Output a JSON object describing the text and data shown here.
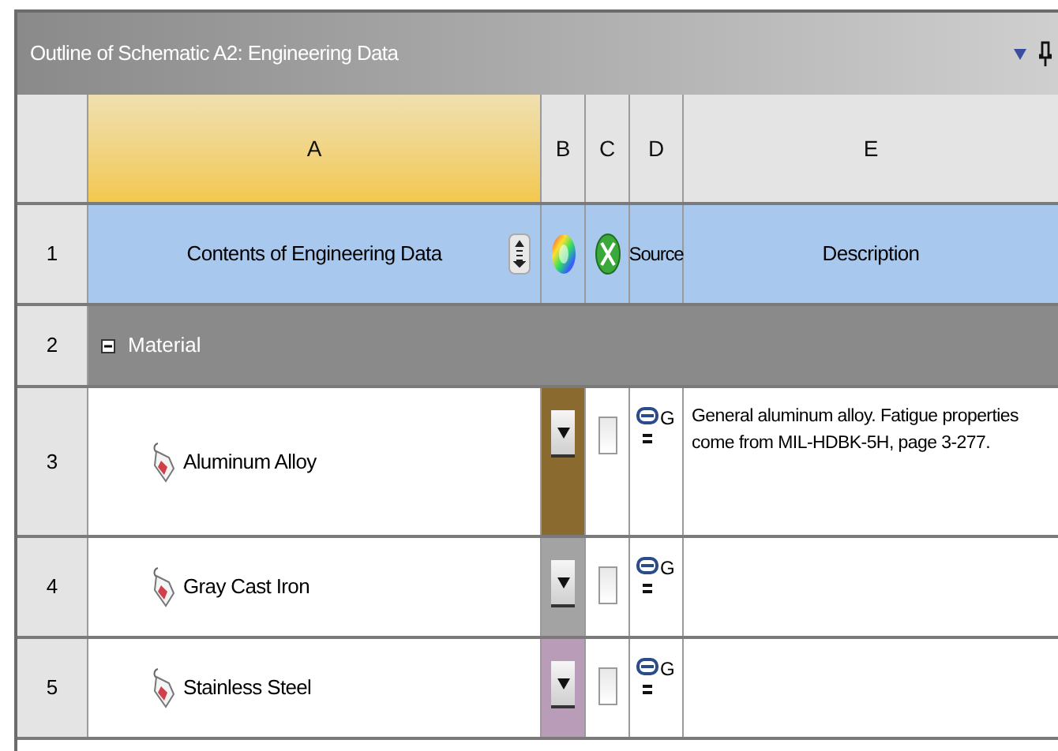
{
  "panel": {
    "title": "Outline of Schematic A2: Engineering Data"
  },
  "columns": [
    {
      "label": "A",
      "selected": true
    },
    {
      "label": "B",
      "selected": false
    },
    {
      "label": "C",
      "selected": false
    },
    {
      "label": "D",
      "selected": false
    },
    {
      "label": "E",
      "selected": false
    }
  ],
  "header_row": {
    "number": "1",
    "contents": "Contents of Engineering Data",
    "source": "Source",
    "description": "Description"
  },
  "group": {
    "number": "2",
    "label": "Material",
    "expanded": true
  },
  "materials": [
    {
      "number": "3",
      "name": "Aluminum Alloy",
      "color": "#8b6a2f",
      "checked": false,
      "source": "G",
      "description": "General aluminum alloy. Fatigue properties come from MIL-HDBK-5H, page 3-277."
    },
    {
      "number": "4",
      "name": "Gray Cast Iron",
      "color": "#a3a3a3",
      "checked": false,
      "source": "G"
    },
    {
      "number": "5",
      "name": "Stainless Steel",
      "color": "#b89cb8",
      "checked": false,
      "source": "G"
    }
  ]
}
